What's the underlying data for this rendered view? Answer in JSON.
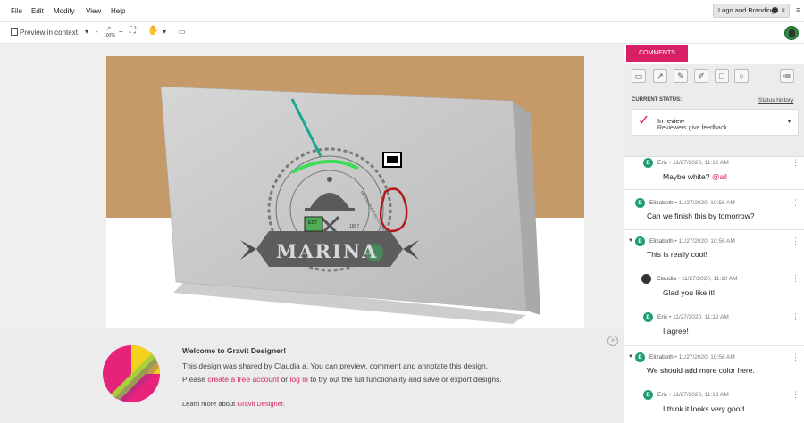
{
  "menu": [
    "File",
    "Edit",
    "Modify",
    "View",
    "Help"
  ],
  "doc_tab": {
    "label": "Logo and Branding"
  },
  "toolbar": {
    "preview": "Preview in context",
    "zoom": "100%"
  },
  "welcome": {
    "title": "Welcome to Gravit Designer!",
    "line1": "This design was shared by Claudia a. You can preview, comment and annotate this design.",
    "line2_pre": "Please ",
    "line2_link1": "create a free account",
    "line2_mid": " or ",
    "line2_link2": "log in",
    "line2_post": " to try out the full functionality and save or export designs.",
    "line3_pre": "Learn more about ",
    "line3_link": "Gravit Designer",
    "line3_post": "."
  },
  "artwork": {
    "logo_word": "MARINA",
    "badge_text": "EST",
    "year": "1897",
    "cuisine_text": "MEDITERRANEAN CUISINE"
  },
  "panel": {
    "tab": "COMMENTS",
    "status_label": "CURRENT STATUS:",
    "status_history": "Status history",
    "status_name": "In review",
    "status_desc": "Reviewers give feedback."
  },
  "comments": [
    {
      "author": "Eric",
      "initial": "E",
      "time": "11/27/2020, 11:12 AM",
      "text": "Maybe white? ",
      "mention": "@all"
    },
    {
      "author": "Elizabeth",
      "initial": "E",
      "time": "11/27/2020, 10:56 AM",
      "text": "Can we finish this by tomorrow?"
    },
    {
      "author": "Elizabeth",
      "initial": "E",
      "time": "11/27/2020, 10:56 AM",
      "text": "This is really cool!"
    },
    {
      "author": "Claudia",
      "initial": "",
      "time": "11/27/2020, 11:10 AM",
      "text": "Glad you like it!"
    },
    {
      "author": "Eric",
      "initial": "E",
      "time": "11/27/2020, 11:12 AM",
      "text": "I agree!"
    },
    {
      "author": "Elizabeth",
      "initial": "E",
      "time": "11/27/2020, 10:56 AM",
      "text": "We should add more color here."
    },
    {
      "author": "Eric",
      "initial": "E",
      "time": "11/27/2020, 11:13 AM",
      "text": "I think it looks very good."
    }
  ],
  "colors": {
    "accent": "#d91f66",
    "avatar": "#1e9e73",
    "tan": "#c59a68"
  }
}
